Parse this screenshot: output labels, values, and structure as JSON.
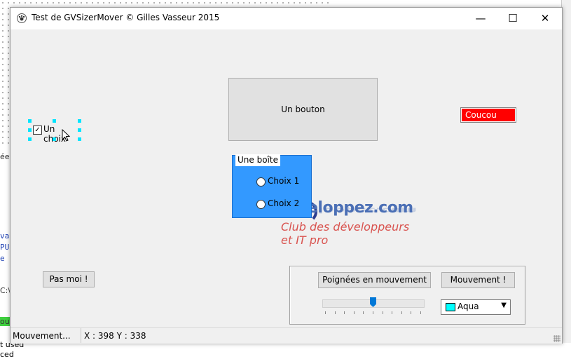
{
  "window": {
    "title": "Test de GVSizerMover  © Gilles Vasseur 2015",
    "minimize_glyph": "—",
    "maximize_glyph": "☐",
    "close_glyph": "✕"
  },
  "checkbox": {
    "label": "Un choix",
    "checked": true,
    "check_glyph": "✓",
    "selection_handle_color": "#00e5ff"
  },
  "main_button": {
    "label": "Un bouton"
  },
  "red_label": {
    "text": "Coucou",
    "color": "#ff0000"
  },
  "groupbox": {
    "title": "Une boîte",
    "color": "#3399ff",
    "options": [
      "Choix 1",
      "Choix 2"
    ]
  },
  "logo": {
    "main": "eloppez.com",
    "line1": "Club des développeurs",
    "line2": "et IT pro"
  },
  "pas_moi_button": {
    "label": "Pas moi !"
  },
  "panel": {
    "handles_button": "Poignées en mouvement",
    "move_button": "Mouvement !",
    "slider": {
      "value": 5,
      "max": 10
    },
    "color_combo": {
      "value": "Aqua",
      "swatch_color": "#00ffff"
    }
  },
  "statusbar": {
    "left": "Mouvement...",
    "coords": "X : 398 Y : 338"
  },
  "background": {
    "left_fragments": [
      "ées",
      "var",
      "PUI",
      "e l",
      "C:\\",
      "ouc",
      "t used",
      "ced"
    ]
  }
}
